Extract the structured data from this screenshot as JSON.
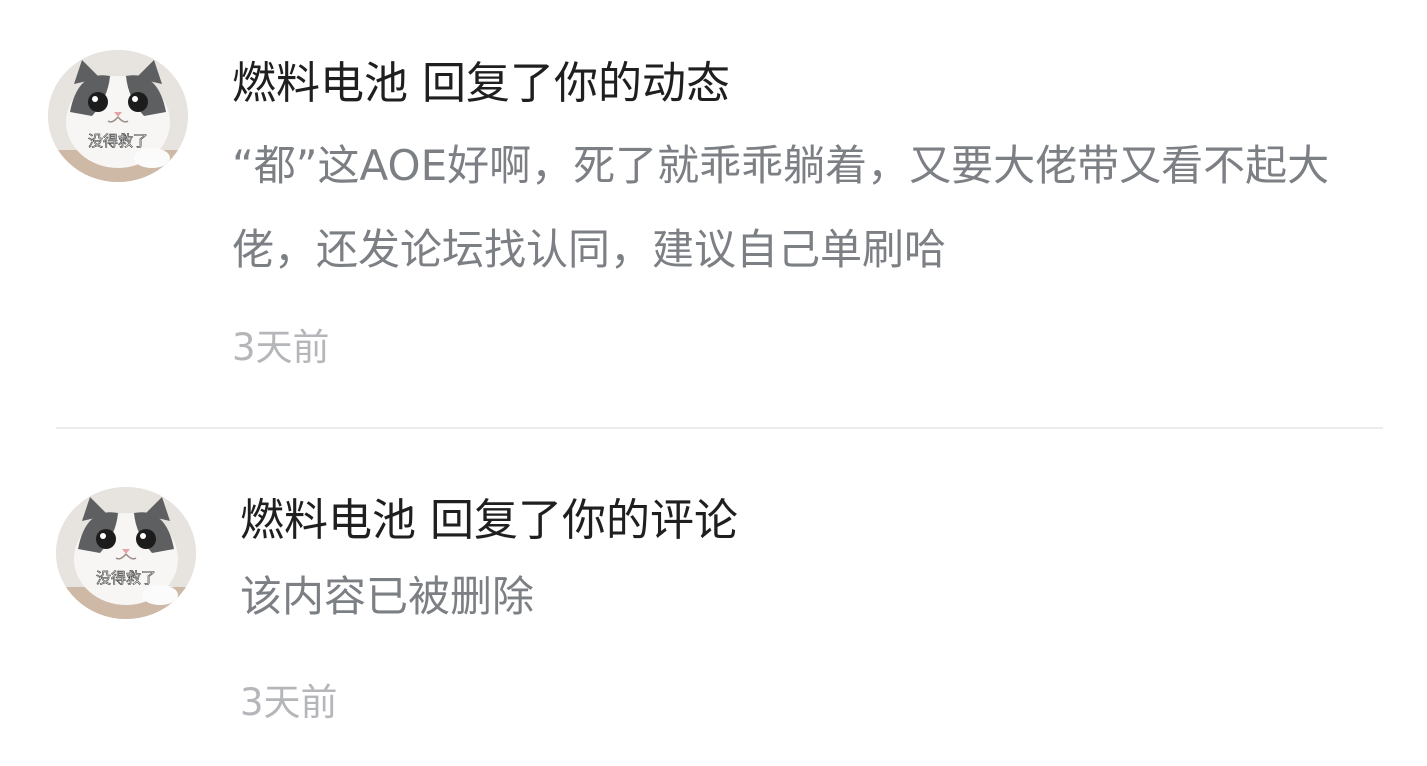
{
  "notifications": [
    {
      "avatar": {
        "icon": "cat-avatar-icon",
        "caption": "没得救了"
      },
      "user": "燃料电池",
      "action": "回复了你的动态",
      "content": "“都”这AOE好啊，死了就乖乖躺着，又要大佬带又看不起大佬，还发论坛找认同，建议自己单刷哈",
      "time": "3天前"
    },
    {
      "avatar": {
        "icon": "cat-avatar-icon",
        "caption": "没得救了"
      },
      "user": "燃料电池",
      "action": "回复了你的评论",
      "content": "该内容已被删除",
      "time": "3天前"
    }
  ],
  "colors": {
    "title": "#1f1f1f",
    "content": "#7c7f84",
    "timestamp": "#b4b6b9",
    "divider": "#ececec",
    "background": "#ffffff"
  }
}
